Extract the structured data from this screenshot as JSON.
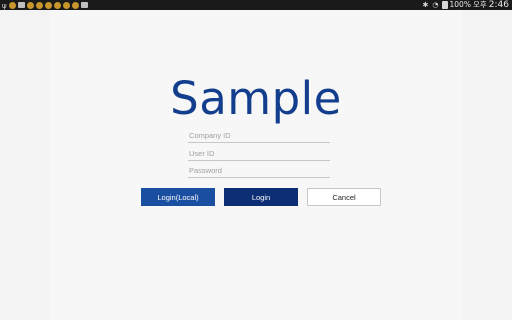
{
  "status_bar": {
    "battery": "100%",
    "period": "오후",
    "time": "2:46",
    "left_icons": [
      "usb-icon",
      "app-notification-icon",
      "message-icon",
      "app-notification-icon",
      "app-notification-icon",
      "app-notification-icon",
      "app-notification-icon",
      "app-notification-icon",
      "app-notification-icon",
      "app-notification-icon"
    ],
    "right_icons": [
      "bluetooth-icon",
      "wifi-icon",
      "battery-icon"
    ]
  },
  "app": {
    "logo": "Sample"
  },
  "form": {
    "company_id_placeholder": "Company ID",
    "user_id_placeholder": "User ID",
    "password_placeholder": "Password",
    "login_local_label": "Login(Local)",
    "login_label": "Login",
    "cancel_label": "Cancel"
  },
  "colors": {
    "brand": "#123e8d",
    "login_local_button": "#1a4ea0",
    "login_button": "#0d2e75",
    "status_bar": "#1a1a1a"
  }
}
